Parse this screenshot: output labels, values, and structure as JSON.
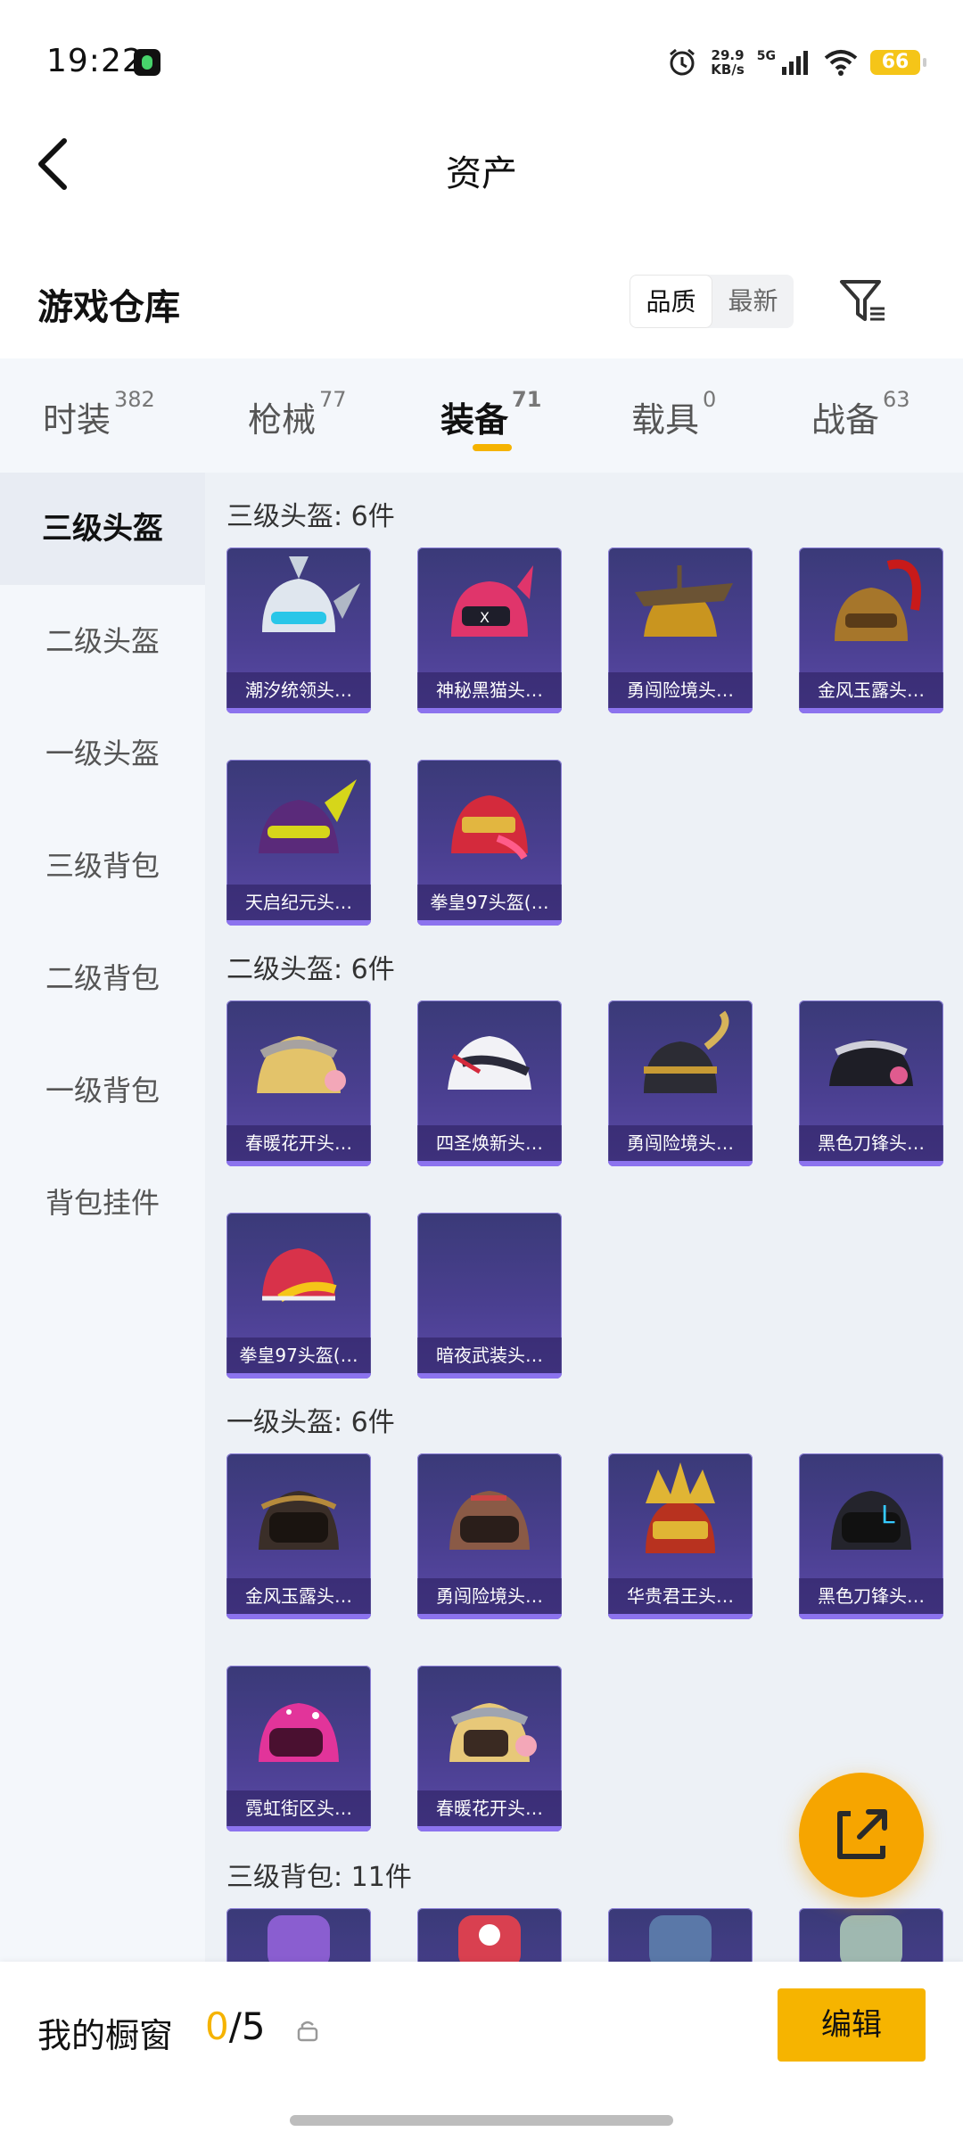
{
  "status_bar": {
    "time": "19:22",
    "net_speed_value": "29.9",
    "net_speed_unit": "KB/s",
    "network": "5G",
    "battery": "66",
    "icons": [
      "alarm-icon",
      "signal-icon",
      "wifi-icon",
      "battery-icon"
    ]
  },
  "header": {
    "title": "资产"
  },
  "section": {
    "title": "游戏仓库"
  },
  "sort": {
    "options": [
      "品质",
      "最新"
    ],
    "active": "品质"
  },
  "tabs": [
    {
      "label": "时装",
      "count": "382"
    },
    {
      "label": "枪械",
      "count": "77"
    },
    {
      "label": "装备",
      "count": "71",
      "active": true
    },
    {
      "label": "载具",
      "count": "0"
    },
    {
      "label": "战备",
      "count": "63"
    }
  ],
  "sidebar": {
    "items": [
      "三级头盔",
      "二级头盔",
      "一级头盔",
      "三级背包",
      "二级背包",
      "一级背包",
      "背包挂件"
    ],
    "active": "三级头盔"
  },
  "groups": [
    {
      "title": "三级头盔: 6件",
      "items": [
        "潮汐统领头…",
        "神秘黑猫头…",
        "勇闯险境头…",
        "金风玉露头…",
        "天启纪元头…",
        "拳皇97头盔(…"
      ]
    },
    {
      "title": "二级头盔: 6件",
      "items": [
        "春暖花开头…",
        "四圣焕新头…",
        "勇闯险境头…",
        "黑色刀锋头…",
        "拳皇97头盔(…",
        "暗夜武装头…"
      ]
    },
    {
      "title": "一级头盔: 6件",
      "items": [
        "金风玉露头…",
        "勇闯险境头…",
        "华贵君王头…",
        "黑色刀锋头…",
        "霓虹街区头…",
        "春暖花开头…"
      ]
    },
    {
      "title": "三级背包: 11件",
      "items": [
        "",
        "",
        "",
        ""
      ]
    }
  ],
  "bottom": {
    "showcase_label": "我的橱窗",
    "showcase_current": "0",
    "showcase_total": "/5",
    "edit_label": "编辑"
  },
  "colors": {
    "accent": "#f5b301",
    "card_bg": "#3f3a85",
    "card_border": "#8c73ee"
  }
}
